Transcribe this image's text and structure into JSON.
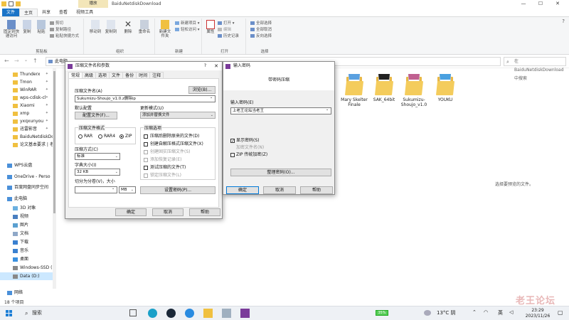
{
  "window": {
    "title": "BaiduNetdiskDownload",
    "context_tab": "播放",
    "buttons": {
      "minimize": "—",
      "maximize": "☐",
      "close": "✕"
    }
  },
  "ribbon": {
    "tabs": [
      "文件",
      "主页",
      "共享",
      "查看",
      "视频工具"
    ],
    "groups": {
      "clipboard": {
        "label": "剪贴板",
        "pin": "固定到快速访问",
        "copy": "复制",
        "paste": "粘贴",
        "cut": "剪切",
        "copy_path": "复制路径",
        "paste_shortcut": "粘贴快捷方式"
      },
      "organize": {
        "label": "组织",
        "move_to": "移动到",
        "copy_to": "复制到",
        "delete": "删除",
        "rename": "重命名"
      },
      "new": {
        "label": "新建",
        "new_folder": "新建文件夹",
        "new_item": "新建项目 ▾",
        "easy_access": "轻松访问 ▾"
      },
      "open": {
        "label": "打开",
        "properties": "属性",
        "open": "打开 ▾",
        "edit": "编辑",
        "history": "历史记录"
      },
      "select": {
        "label": "选择",
        "select_all": "全部选择",
        "select_none": "全部取消",
        "invert": "反向选择"
      }
    }
  },
  "address": {
    "path": "此电脑",
    "search_placeholder": "在 BaiduNetdiskDownload 中搜索"
  },
  "nav": {
    "items": [
      {
        "label": "Thunderx",
        "icon": "folder-icon",
        "pinned": true
      },
      {
        "label": "Tmon",
        "icon": "folder-icon",
        "pinned": true
      },
      {
        "label": "WinRAR",
        "icon": "folder-icon",
        "pinned": true
      },
      {
        "label": "wps-cdisk-cl",
        "icon": "folder-icon",
        "pinned": true
      },
      {
        "label": "Xiaomi",
        "icon": "folder-icon",
        "pinned": true
      },
      {
        "label": "xmp",
        "icon": "folder-icon",
        "pinned": true
      },
      {
        "label": "yxqxunyou",
        "icon": "folder-icon",
        "pinned": true
      },
      {
        "label": "迅雷影音",
        "icon": "folder-icon",
        "pinned": true
      },
      {
        "label": "BaiduNetdiskDo",
        "icon": "folder-icon",
        "pinned": false
      },
      {
        "label": "论文基本要求 | 老",
        "icon": "folder-icon",
        "pinned": false
      },
      {
        "label": "WPS云盘",
        "icon": "cloud-icon",
        "pinned": false
      },
      {
        "label": "OneDrive - Perso",
        "icon": "cloud-icon",
        "pinned": false
      },
      {
        "label": "百度网盘同步空间",
        "icon": "cloud-icon",
        "pinned": false
      },
      {
        "label": "此电脑",
        "icon": "computer-icon",
        "pinned": false
      },
      {
        "label": "3D 对象",
        "icon": "3d-icon",
        "pinned": false
      },
      {
        "label": "视频",
        "icon": "video-icon",
        "pinned": false
      },
      {
        "label": "图片",
        "icon": "picture-icon",
        "pinned": false
      },
      {
        "label": "文档",
        "icon": "document-icon",
        "pinned": false
      },
      {
        "label": "下载",
        "icon": "download-icon",
        "pinned": false
      },
      {
        "label": "音乐",
        "icon": "music-icon",
        "pinned": false
      },
      {
        "label": "桌面",
        "icon": "desktop-icon",
        "pinned": false
      },
      {
        "label": "Windows-SSD (",
        "icon": "drive-icon",
        "pinned": false
      },
      {
        "label": "Data (D:)",
        "icon": "drive-icon",
        "pinned": false
      },
      {
        "label": "网络",
        "icon": "network-icon",
        "pinned": false
      }
    ]
  },
  "status": {
    "count": "18 个项目"
  },
  "files": [
    {
      "name": "Mary Skelter Finale",
      "accent": "#5aa0e0"
    },
    {
      "name": "SAK_64bit",
      "accent": "#222222"
    },
    {
      "name": "Sukumizu-Shoujo_v1.0",
      "accent": "#c06090"
    },
    {
      "name": "YOUKU",
      "accent": "#4aa0e0"
    }
  ],
  "preview_text": "选择要预览的文件。",
  "archive_dialog": {
    "title": "压缩文件名和参数",
    "help_q": "?",
    "close": "✕",
    "tabs": [
      "常规",
      "高级",
      "选项",
      "文件",
      "备份",
      "时间",
      "注释"
    ],
    "archive_name_label": "压缩文件名(A)",
    "browse": "浏览(B)...",
    "archive_name": "Sukumizu-Shoujo_v1.0.z删除ip",
    "default_profile_label": "默认配置",
    "profiles_button": "配置文件(F)...",
    "update_mode_label": "更新模式(U)",
    "update_mode": "添加并替换文件",
    "format_group": "压缩文件格式",
    "formats": [
      "RAR",
      "RAR4",
      "ZIP"
    ],
    "selected_format": "ZIP",
    "method_label": "压缩方式(C)",
    "method": "标准",
    "dict_label": "字典大小(I)",
    "dict": "32 KB",
    "split_label": "切分为分卷(V)，大小",
    "split_unit": "MB",
    "options_group": "压缩选项",
    "options": [
      {
        "label": "压缩后删除原来的文件(D)",
        "checked": false,
        "disabled": false
      },
      {
        "label": "创建自解压格式压缩文件(X)",
        "checked": false,
        "disabled": false
      },
      {
        "label": "创建固实压缩文件(S)",
        "checked": false,
        "disabled": true
      },
      {
        "label": "添加恢复记录(E)",
        "checked": false,
        "disabled": true
      },
      {
        "label": "测试压缩的文件(T)",
        "checked": false,
        "disabled": false
      },
      {
        "label": "锁定压缩文件(L)",
        "checked": false,
        "disabled": true
      }
    ],
    "set_password": "设置密码(P)...",
    "ok": "确定",
    "cancel": "取消",
    "help": "帮助"
  },
  "password_dialog": {
    "title": "输入密码",
    "heading": "带密码压缩",
    "password_label": "输入密码(E)",
    "password_value": "上老王论坛当老王",
    "show_password": "显示密码(S)",
    "show_password_checked": true,
    "encrypt_names": "加密文件名(N)",
    "zip_legacy": "ZIP 传统加密(Z)",
    "zip_legacy_checked": false,
    "organize": "整理密码(O)...",
    "ok": "确定",
    "cancel": "取消",
    "help": "帮助"
  },
  "taskbar": {
    "search": "搜索",
    "battery": "35%",
    "weather": "13°C 阴",
    "ime": "英",
    "time": "23:29",
    "date": "2023/11/26"
  },
  "watermark": "老王论坛"
}
